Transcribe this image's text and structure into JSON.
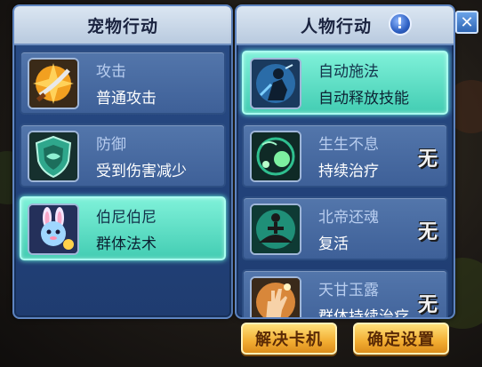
{
  "pet_panel": {
    "title": "宠物行动",
    "items": [
      {
        "title": "攻击",
        "desc": "普通攻击",
        "icon": "sword-attack-icon",
        "selected": false
      },
      {
        "title": "防御",
        "desc": "受到伤害减少",
        "icon": "shield-defense-icon",
        "selected": false
      },
      {
        "title": "伯尼伯尼",
        "desc": "群体法术",
        "icon": "bunny-pet-icon",
        "selected": true
      }
    ]
  },
  "char_panel": {
    "title": "人物行动",
    "help_label": "!",
    "items": [
      {
        "title": "自动施法",
        "desc": "自动释放技能",
        "icon": "auto-cast-icon",
        "selected": true,
        "badge": ""
      },
      {
        "title": "生生不息",
        "desc": "持续治疗",
        "icon": "heal-orb-icon",
        "selected": false,
        "badge": "无"
      },
      {
        "title": "北帝还魂",
        "desc": "复活",
        "icon": "meditate-revive-icon",
        "selected": false,
        "badge": "无"
      },
      {
        "title": "天甘玉露",
        "desc": "群体持续治疗",
        "icon": "hand-dew-icon",
        "selected": false,
        "badge": "无"
      }
    ]
  },
  "buttons": {
    "unstuck": "解决卡机",
    "confirm": "确定设置",
    "close": "✕"
  },
  "colors": {
    "panel_blue": "#22427a",
    "selected_teal": "#43cdb3",
    "gold_button": "#f2ad32"
  }
}
